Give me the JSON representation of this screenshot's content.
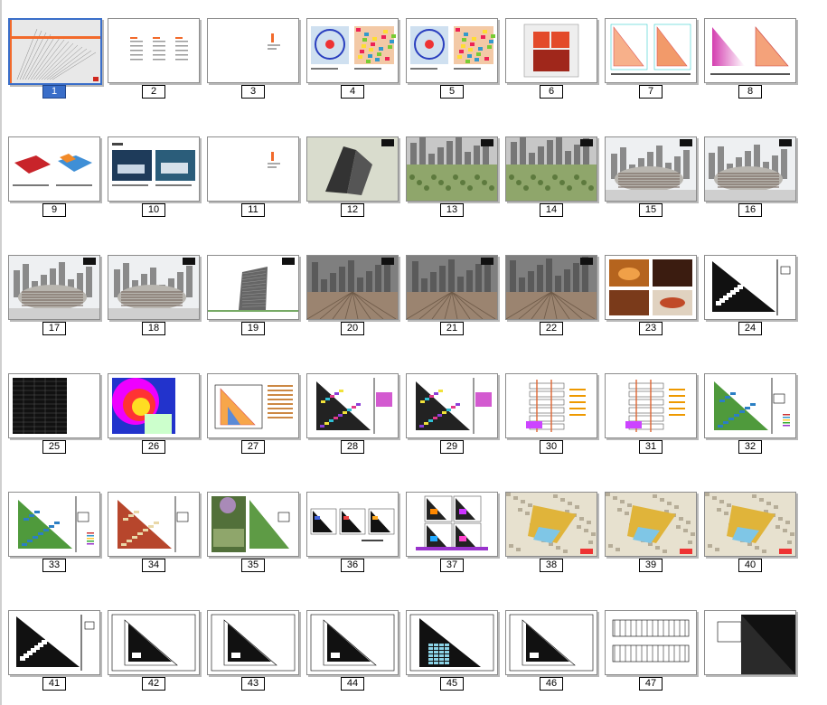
{
  "app": {
    "view": "slide-sorter",
    "selected_slide": "1"
  },
  "slides": [
    {
      "number": "1",
      "kind": "cover"
    },
    {
      "number": "2",
      "kind": "toc"
    },
    {
      "number": "3",
      "kind": "section"
    },
    {
      "number": "4",
      "kind": "maps"
    },
    {
      "number": "5",
      "kind": "maps"
    },
    {
      "number": "6",
      "kind": "site-blocks"
    },
    {
      "number": "7",
      "kind": "triangle-pair"
    },
    {
      "number": "8",
      "kind": "triangle-gradient"
    },
    {
      "number": "9",
      "kind": "massing"
    },
    {
      "number": "10",
      "kind": "photos"
    },
    {
      "number": "11",
      "kind": "section"
    },
    {
      "number": "12",
      "kind": "render"
    },
    {
      "number": "13",
      "kind": "render-green"
    },
    {
      "number": "14",
      "kind": "render-green"
    },
    {
      "number": "15",
      "kind": "render-building"
    },
    {
      "number": "16",
      "kind": "render-building"
    },
    {
      "number": "17",
      "kind": "render-building"
    },
    {
      "number": "18",
      "kind": "render-building"
    },
    {
      "number": "19",
      "kind": "tower"
    },
    {
      "number": "20",
      "kind": "render-street"
    },
    {
      "number": "21",
      "kind": "render-street"
    },
    {
      "number": "22",
      "kind": "render-street"
    },
    {
      "number": "23",
      "kind": "photo-grid"
    },
    {
      "number": "24",
      "kind": "plan-black"
    },
    {
      "number": "25",
      "kind": "table-dark"
    },
    {
      "number": "26",
      "kind": "heatmap"
    },
    {
      "number": "27",
      "kind": "diagram-triangle"
    },
    {
      "number": "28",
      "kind": "plan-color"
    },
    {
      "number": "29",
      "kind": "plan-color"
    },
    {
      "number": "30",
      "kind": "section-diagram"
    },
    {
      "number": "31",
      "kind": "section-diagram"
    },
    {
      "number": "32",
      "kind": "plan-green"
    },
    {
      "number": "33",
      "kind": "plan-green"
    },
    {
      "number": "34",
      "kind": "plan-red"
    },
    {
      "number": "35",
      "kind": "plan-photo"
    },
    {
      "number": "36",
      "kind": "three-plans"
    },
    {
      "number": "37",
      "kind": "four-plans"
    },
    {
      "number": "38",
      "kind": "aerial-yellow"
    },
    {
      "number": "39",
      "kind": "aerial-yellow"
    },
    {
      "number": "40",
      "kind": "aerial-yellow"
    },
    {
      "number": "41",
      "kind": "plan-black"
    },
    {
      "number": "42",
      "kind": "plan-line"
    },
    {
      "number": "43",
      "kind": "plan-line"
    },
    {
      "number": "44",
      "kind": "plan-line"
    },
    {
      "number": "45",
      "kind": "plan-grid"
    },
    {
      "number": "46",
      "kind": "plan-line"
    },
    {
      "number": "47",
      "kind": "elevation"
    },
    {
      "number": "",
      "kind": "partial"
    }
  ],
  "colors": {
    "selection": "#3a6ec9",
    "accent_orange": "#f26a2b",
    "plan_green": "#4f9a3c"
  }
}
